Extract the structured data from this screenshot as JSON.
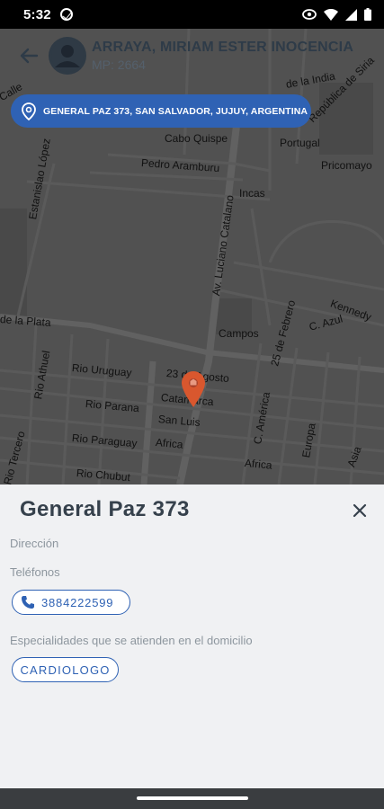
{
  "status_bar": {
    "time": "5:32",
    "icons": [
      "sync-icon",
      "eye-icon",
      "wifi-icon",
      "signal-icon",
      "battery-icon"
    ]
  },
  "header": {
    "doctor_name": "ARRAYA, MIRIAM ESTER INOCENCIA",
    "mp": "MP: 2664",
    "back_icon": "arrow-left-icon",
    "avatar_icon": "person-icon"
  },
  "address_pill": {
    "text": "GENERAL PAZ 373, SAN SALVADOR, JUJUY, ARGENTINA",
    "icon": "location-pin-icon"
  },
  "map": {
    "streets": [
      "Cabo Quispe",
      "Pedro Aramburu",
      "Estanislao López",
      "Av. Luciano Catalano",
      "Incas",
      "Portugal",
      "Pricomayo",
      "de la Plata",
      "Rio Athuel",
      "Rio Uruguay",
      "Rio Parana",
      "Rio Paraguay",
      "Rio Chubut",
      "Rio Tercero",
      "23 de Agosto",
      "Catamarca",
      "San Luis",
      "Africa",
      "Campos",
      "25 de Febrero",
      "C. Azul",
      "Kennedy",
      "C. América",
      "Europa",
      "Asia",
      "Africa",
      "República de Siria",
      "de la India",
      "Calle"
    ],
    "marker_icon": "map-marker-icon"
  },
  "sheet": {
    "title": "General Paz 373",
    "direccion_label": "Dirección",
    "telefonos_label": "Teléfonos",
    "phone": "3884222599",
    "especialidades_label": "Especialidades que se atienden en el domicilio",
    "specialty": "CARDIOLOGO",
    "close_icon": "close-icon"
  },
  "colors": {
    "accent": "#2f62b4",
    "marker": "#d9572e",
    "title": "#36414c"
  }
}
